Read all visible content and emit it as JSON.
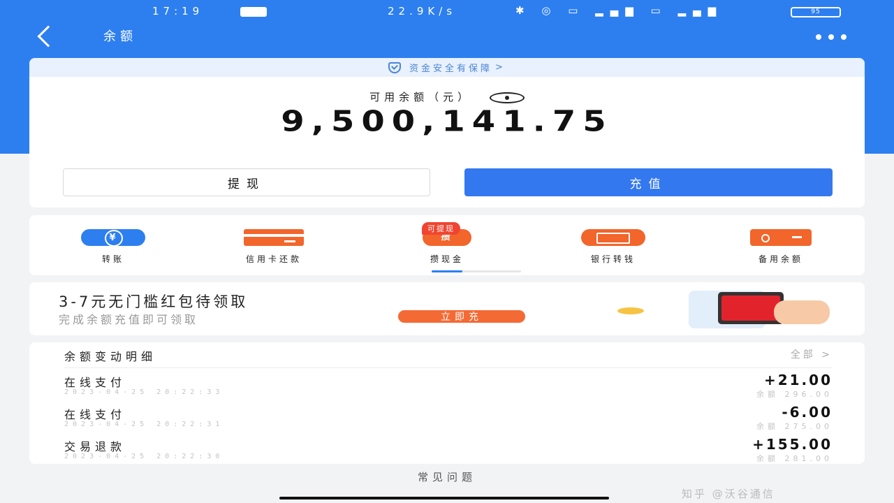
{
  "status_bar": {
    "time": "17:19",
    "network_speed": "22.9K/s",
    "icons": [
      "bluetooth-icon",
      "alarm-icon",
      "hd-icon",
      "signal-icon",
      "hd-icon",
      "signal-icon"
    ],
    "battery": "95"
  },
  "header": {
    "title": "余额",
    "back_icon": "back-chevron-icon",
    "more_icon": "more-dots-icon"
  },
  "balance": {
    "safety_text": "资金安全有保障",
    "safety_arrow": ">",
    "available_label": "可用余额（元）",
    "amount": "9,500,141.75",
    "withdraw_label": "提现",
    "recharge_label": "充值"
  },
  "services": [
    {
      "label": "转账",
      "icon": "transfer-icon"
    },
    {
      "label": "信用卡还款",
      "icon": "credit-card-icon"
    },
    {
      "label": "攒现金",
      "icon": "cash-icon",
      "icon_text": "攒",
      "badge": "可提现"
    },
    {
      "label": "银行转钱",
      "icon": "bank-transfer-icon"
    },
    {
      "label": "备用余额",
      "icon": "wallet-icon"
    }
  ],
  "promo": {
    "title": "3-7元无门槛红包待领取",
    "subtitle": "完成余额充值即可领取",
    "button": "立即充"
  },
  "transactions": {
    "title": "余额变动明细",
    "all_label": "全部",
    "all_arrow": ">",
    "rows": [
      {
        "name": "在线支付",
        "time": "2023-04-25 20:22:33",
        "amount": "+21.00",
        "balance": "余额 296.00"
      },
      {
        "name": "在线支付",
        "time": "2023-04-25 20:22:31",
        "amount": "-6.00",
        "balance": "余额 275.00"
      },
      {
        "name": "交易退款",
        "time": "2023-04-25 20:22:30",
        "amount": "+155.00",
        "balance": "余额 281.00"
      }
    ]
  },
  "faq": "常见问题",
  "watermark": "知乎 @沃谷通信",
  "colors": {
    "primary": "#2d7ff0",
    "accent_orange": "#f2652b",
    "background": "#f2f3f5"
  }
}
